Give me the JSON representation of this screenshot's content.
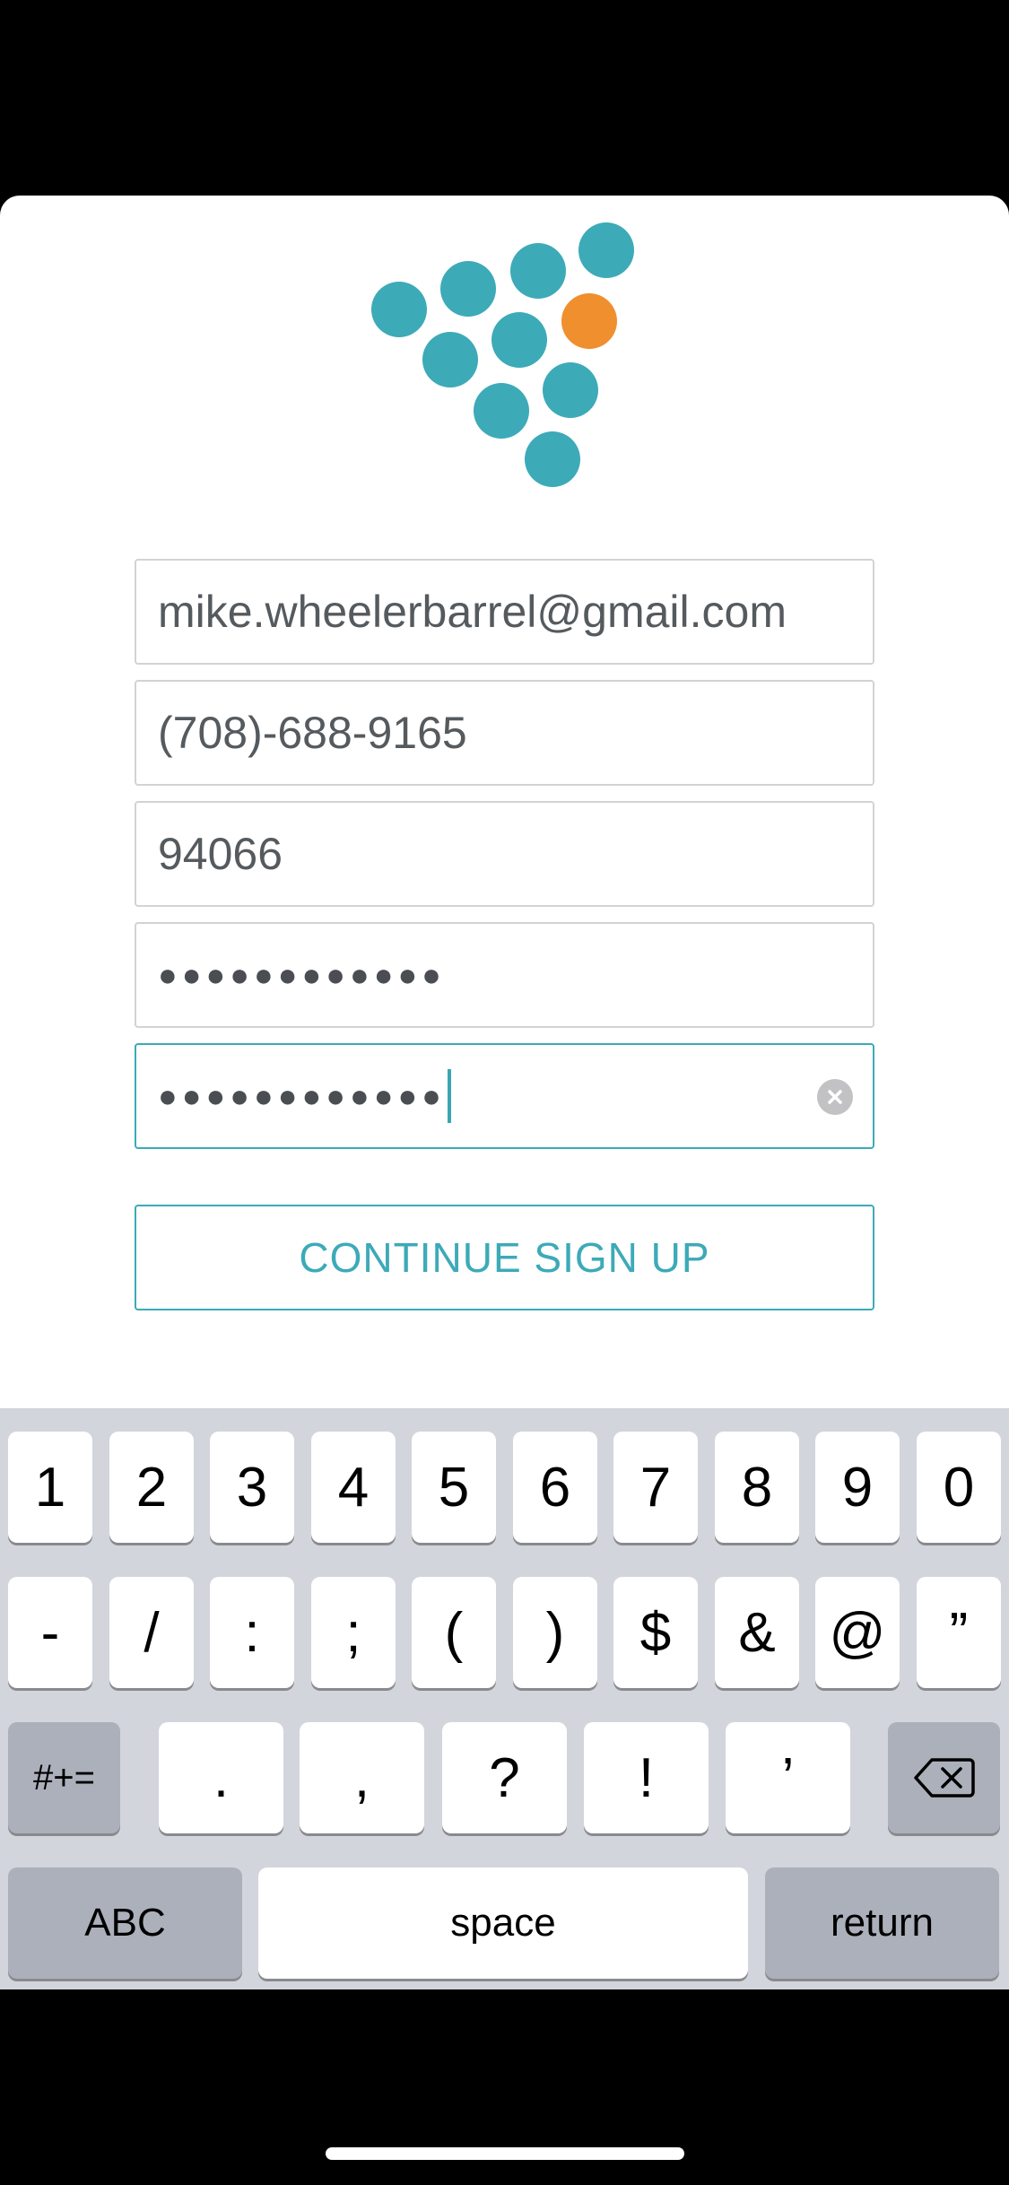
{
  "form": {
    "email_value": "mike.wheelerbarrel@gmail.com",
    "phone_value": "(708)-688-9165",
    "zip_value": "94066",
    "password_value": "●●●●●●●●●●●●",
    "confirm_password_value": "●●●●●●●●●●●●",
    "clear_icon": "clear-x-icon"
  },
  "cta": {
    "label": "CONTINUE SIGN UP"
  },
  "keyboard": {
    "row1": [
      "1",
      "2",
      "3",
      "4",
      "5",
      "6",
      "7",
      "8",
      "9",
      "0"
    ],
    "row2": [
      "-",
      "/",
      ":",
      ";",
      "(",
      ")",
      "$",
      "&",
      "@",
      "”"
    ],
    "row3_toggle": "#+=",
    "row3": [
      ".",
      ",",
      "?",
      "!",
      "’"
    ],
    "delete_icon": "backspace-icon",
    "abc_label": "ABC",
    "space_label": "space",
    "return_label": "return"
  },
  "colors": {
    "brand_teal": "#3daab8",
    "brand_orange": "#f08f2e"
  }
}
